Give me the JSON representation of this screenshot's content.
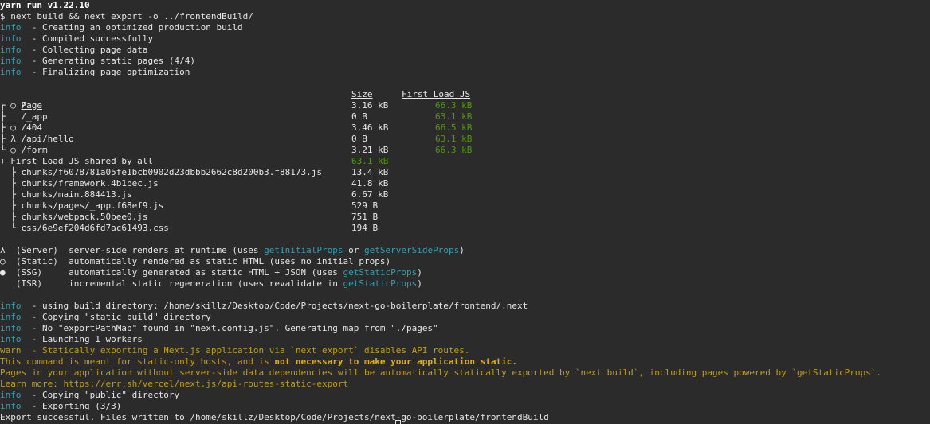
{
  "header": {
    "yarn_version": "yarn run v1.22.10",
    "command": "$ next build && next export -o ../frontendBuild/"
  },
  "build_log": [
    {
      "tag": "info",
      "text": "  - Creating an optimized production build"
    },
    {
      "tag": "info",
      "text": "  - Compiled successfully"
    },
    {
      "tag": "info",
      "text": "  - Collecting page data"
    },
    {
      "tag": "info",
      "text": "  - Generating static pages (4/4)"
    },
    {
      "tag": "info",
      "text": "  - Finalizing page optimization"
    }
  ],
  "table": {
    "header_page": "Page",
    "header_size": "Size",
    "header_first_load": "First Load JS",
    "rows": [
      {
        "prefix": "┌ ○ ",
        "path": "/",
        "size": "3.16 kB",
        "first_load": "66.3 kB"
      },
      {
        "prefix": "├   ",
        "path": "/_app",
        "size": "0 B",
        "first_load": "63.1 kB"
      },
      {
        "prefix": "├ ○ ",
        "path": "/404",
        "size": "3.46 kB",
        "first_load": "66.5 kB"
      },
      {
        "prefix": "├ λ ",
        "path": "/api/hello",
        "size": "0 B",
        "first_load": "63.1 kB"
      },
      {
        "prefix": "└ ○ ",
        "path": "/form",
        "size": "3.21 kB",
        "first_load": "66.3 kB"
      }
    ],
    "shared_label": "+ First Load JS shared by all",
    "shared_value": "63.1 kB",
    "chunks": [
      {
        "prefix": "  ├ ",
        "path": "chunks/f6078781a05fe1bcb0902d23dbbb2662c8d200b3.f88173.js",
        "size": "13.4 kB"
      },
      {
        "prefix": "  ├ ",
        "path": "chunks/framework.4b1bec.js",
        "size": "41.8 kB"
      },
      {
        "prefix": "  ├ ",
        "path": "chunks/main.884413.js",
        "size": "6.67 kB"
      },
      {
        "prefix": "  ├ ",
        "path": "chunks/pages/_app.f68ef9.js",
        "size": "529 B"
      },
      {
        "prefix": "  ├ ",
        "path": "chunks/webpack.50bee0.js",
        "size": "751 B"
      },
      {
        "prefix": "  └ ",
        "path": "css/6e9ef204d6fd7ac61493.css",
        "size": "194 B"
      }
    ]
  },
  "legend": [
    {
      "text": "λ  (Server)  server-side renders at runtime (uses ",
      "links": [
        "getInitialProps",
        " or ",
        "getServerSideProps"
      ],
      "tail": ")"
    },
    {
      "text": "○  (Static)  automatically rendered as static HTML (uses no initial props)"
    },
    {
      "text": "●  (SSG)     automatically generated as static HTML + JSON (uses ",
      "links": [
        "getStaticProps"
      ],
      "tail": ")"
    },
    {
      "text": "   (ISR)     incremental static regeneration (uses revalidate in ",
      "links": [
        "getStaticProps"
      ],
      "tail": ")"
    }
  ],
  "export_log": {
    "l1_tag": "info",
    "l1_text": "  - using build directory: /home/skillz/Desktop/Code/Projects/next-go-boilerplate/frontend/.next",
    "l2_tag": "info",
    "l2_text": "  - Copying \"static build\" directory",
    "l3_tag": "info",
    "l3_text": "  - No \"exportPathMap\" found in \"next.config.js\". Generating map from \"./pages\"",
    "l4_tag": "info",
    "l4_text": "  - Launching 1 workers",
    "warn_tag": "warn",
    "warn_text": "  - Statically exporting a Next.js application via `next export` disables API routes.",
    "meant_a": "This command is meant for static-only hosts, and is ",
    "meant_b": "not necessary to make your application static.",
    "pages_text": "Pages in your application without server-side data dependencies will be automatically statically exported by `next build`, including pages powered by `getStaticProps`.",
    "learn_text": "Learn more: https://err.sh/vercel/next.js/api-routes-static-export",
    "l5_tag": "info",
    "l5_text": "  - Copying \"public\" directory",
    "l6_tag": "info",
    "l6_text": "  - Exporting (3/3)",
    "final": "Export successful. Files written to /home/skillz/Desktop/Code/Projects/next-go-boilerplate/frontendBuild"
  }
}
